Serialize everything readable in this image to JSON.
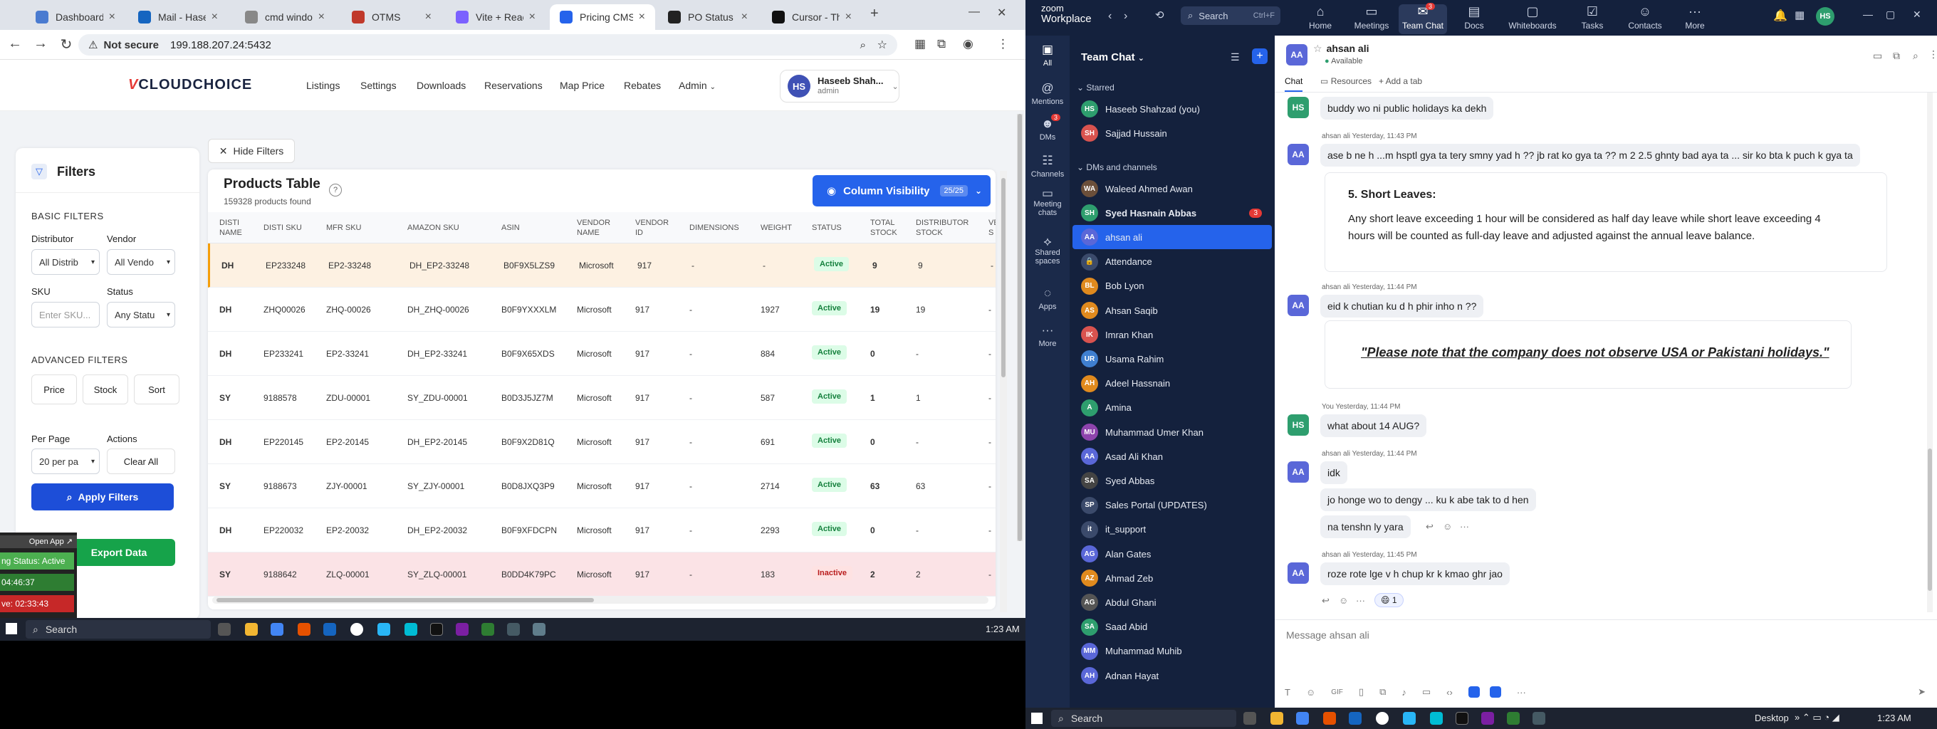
{
  "browser": {
    "tabs": [
      {
        "label": "Dashboard",
        "color": "#4a7bd0"
      },
      {
        "label": "Mail - Haseeb",
        "color": "#1565c0"
      },
      {
        "label": "cmd windows",
        "color": "#888888"
      },
      {
        "label": "OTMS",
        "color": "#c0392b"
      },
      {
        "label": "Vite + React",
        "color": "#7b61ff"
      },
      {
        "label": "Pricing CMS",
        "color": "#2563eb"
      },
      {
        "label": "PO Status API",
        "color": "#222222"
      },
      {
        "label": "Cursor - The A",
        "color": "#111111"
      }
    ],
    "new_tab_icon": "+",
    "not_secure": "Not secure",
    "url": "199.188.207.24:5432"
  },
  "app": {
    "logo_mark": "V",
    "logo_text": "CLOUDCHOICE",
    "nav": [
      "Listings",
      "Settings",
      "Downloads",
      "Reservations",
      "Map Price",
      "Rebates",
      "Admin"
    ],
    "user": {
      "initials": "HS",
      "name": "Haseeb Shah...",
      "role": "admin"
    },
    "hide_filters": "Hide Filters",
    "filters": {
      "title": "Filters",
      "basic": "BASIC FILTERS",
      "distributor_label": "Distributor",
      "distributor_value": "All Distrib",
      "vendor_label": "Vendor",
      "vendor_value": "All Vendo",
      "sku_label": "SKU",
      "sku_placeholder": "Enter SKU...",
      "status_label": "Status",
      "status_value": "Any Statu",
      "advanced": "ADVANCED FILTERS",
      "price": "Price",
      "stock": "Stock",
      "sort": "Sort",
      "per_page_label": "Per Page",
      "per_page_value": "20 per pa",
      "actions_label": "Actions",
      "clear_all": "Clear All",
      "apply": "Apply Filters",
      "export": "Export Data"
    },
    "table": {
      "title": "Products Table",
      "count": "159328 products found",
      "column_visibility": "Column Visibility",
      "column_count": "25/25",
      "headers": [
        "DISTI NAME",
        "DISTI SKU",
        "MFR SKU",
        "AMAZON SKU",
        "ASIN",
        "VENDOR NAME",
        "VENDOR ID",
        "DIMENSIONS",
        "WEIGHT",
        "STATUS",
        "TOTAL STOCK",
        "DISTRIBUTOR STOCK",
        "VE S"
      ],
      "rows": [
        [
          "DH",
          "EP233248",
          "EP2-33248",
          "DH_EP2-33248",
          "B0F9X5LZS9",
          "Microsoft",
          "917",
          "-",
          "-",
          "Active",
          "9",
          "9",
          "-"
        ],
        [
          "DH",
          "ZHQ00026",
          "ZHQ-00026",
          "DH_ZHQ-00026",
          "B0F9YXXXLM",
          "Microsoft",
          "917",
          "-",
          "1927",
          "Active",
          "19",
          "19",
          "-"
        ],
        [
          "DH",
          "EP233241",
          "EP2-33241",
          "DH_EP2-33241",
          "B0F9X65XDS",
          "Microsoft",
          "917",
          "-",
          "884",
          "Active",
          "0",
          "-",
          "-"
        ],
        [
          "SY",
          "9188578",
          "ZDU-00001",
          "SY_ZDU-00001",
          "B0D3J5JZ7M",
          "Microsoft",
          "917",
          "-",
          "587",
          "Active",
          "1",
          "1",
          "-"
        ],
        [
          "DH",
          "EP220145",
          "EP2-20145",
          "DH_EP2-20145",
          "B0F9X2D81Q",
          "Microsoft",
          "917",
          "-",
          "691",
          "Active",
          "0",
          "-",
          "-"
        ],
        [
          "SY",
          "9188673",
          "ZJY-00001",
          "SY_ZJY-00001",
          "B0D8JXQ3P9",
          "Microsoft",
          "917",
          "-",
          "2714",
          "Active",
          "63",
          "63",
          "-"
        ],
        [
          "DH",
          "EP220032",
          "EP2-20032",
          "DH_EP2-20032",
          "B0F9XFDCPN",
          "Microsoft",
          "917",
          "-",
          "2293",
          "Active",
          "0",
          "-",
          "-"
        ],
        [
          "SY",
          "9188642",
          "ZLQ-00001",
          "SY_ZLQ-00001",
          "B0DD4K79PC",
          "Microsoft",
          "917",
          "-",
          "183",
          "Inactive",
          "2",
          "2",
          "-"
        ]
      ]
    },
    "widget": {
      "open_app": "Open App ↗",
      "status": "ng Status: Active",
      "time1": "04:46:37",
      "time2": "ve: 02:33:43"
    }
  },
  "taskbar_left": {
    "search": "Search",
    "time": "1:23 AM"
  },
  "zoom": {
    "brand_top": "zoom",
    "brand": "Workplace",
    "search": "Search",
    "search_shortcut": "Ctrl+F",
    "tabs": [
      "Home",
      "Meetings",
      "Team Chat",
      "Docs",
      "Whiteboards",
      "Tasks",
      "Contacts",
      "More"
    ],
    "team_chat_badge": "3",
    "rail": [
      "All",
      "Mentions",
      "DMs",
      "Channels",
      "Meeting chats",
      "Shared spaces",
      "Apps",
      "More"
    ],
    "dms_badge": "3",
    "list_title": "Team Chat",
    "starred": "Starred",
    "dms_channels": "DMs and channels",
    "starred_items": [
      {
        "name": "Haseeb Shahzad (you)",
        "ini": "HS",
        "color": "#2e9e6e"
      },
      {
        "name": "Sajjad Hussain",
        "ini": "SH",
        "color": "#d9534f"
      }
    ],
    "items": [
      {
        "name": "Waleed Ahmed Awan",
        "ini": "WA",
        "color": "#6b4f3a"
      },
      {
        "name": "Syed Hasnain Abbas",
        "ini": "SH",
        "color": "#2e9e6e",
        "badge": "3"
      },
      {
        "name": "ahsan ali",
        "ini": "AA",
        "color": "#5a67d8"
      },
      {
        "name": "Attendance",
        "ini": "🔒",
        "color": "#3b4a6b"
      },
      {
        "name": "Bob Lyon",
        "ini": "BL",
        "color": "#e08a1e"
      },
      {
        "name": "Ahsan Saqib",
        "ini": "AS",
        "color": "#e08a1e"
      },
      {
        "name": "Imran Khan",
        "ini": "IK",
        "color": "#d9534f"
      },
      {
        "name": "Usama Rahim",
        "ini": "UR",
        "color": "#3f7fd0"
      },
      {
        "name": "Adeel Hassnain",
        "ini": "AH",
        "color": "#e08a1e"
      },
      {
        "name": "Amina",
        "ini": "A",
        "color": "#2e9e6e"
      },
      {
        "name": "Muhammad Umer Khan",
        "ini": "MU",
        "color": "#8e44ad"
      },
      {
        "name": "Asad Ali Khan",
        "ini": "AA",
        "color": "#5a67d8"
      },
      {
        "name": "Syed Abbas",
        "ini": "SA",
        "color": "#444"
      },
      {
        "name": "Sales Portal (UPDATES)",
        "ini": "SP",
        "color": "#3b4a6b"
      },
      {
        "name": "it_support",
        "ini": "it",
        "color": "#3b4a6b"
      },
      {
        "name": "Alan Gates",
        "ini": "AG",
        "color": "#5a67d8"
      },
      {
        "name": "Ahmad Zeb",
        "ini": "AZ",
        "color": "#e08a1e"
      },
      {
        "name": "Abdul Ghani",
        "ini": "AG",
        "color": "#555"
      },
      {
        "name": "Saad Abid",
        "ini": "SA",
        "color": "#2e9e6e"
      },
      {
        "name": "Muhammad Muhib",
        "ini": "MM",
        "color": "#5a67d8"
      },
      {
        "name": "Adnan Hayat",
        "ini": "AH",
        "color": "#5a67d8"
      }
    ],
    "chat": {
      "name": "ahsan ali",
      "status": "Available",
      "tabs": [
        "Chat",
        "Resources",
        "+ Add a tab"
      ],
      "m0": "buddy wo ni public holidays ka dekh",
      "m1_meta": "ahsan ali  Yesterday, 11:43 PM",
      "m1": "ase b ne h ...m hsptl gya ta tery smny yad h ?? jb rat ko gya ta ?? m 2 2.5 ghnty bad aya ta ... sir ko bta k puch k gya ta",
      "card1_title": "5. Short Leaves:",
      "card1_body1": "Any short leave exceeding 1 hour will be considered as half day leave while short leave exceeding 4",
      "card1_body2": "hours will be counted as full-day leave and adjusted against the annual leave balance.",
      "m2_meta": "ahsan ali  Yesterday, 11:44 PM",
      "m2": "eid k chutian ku d h phir inho n ??",
      "card2": "\"Please note that the company does not observe USA or Pakistani holidays.\"",
      "m3_meta": "You  Yesterday, 11:44 PM",
      "m3": "what about 14 AUG?",
      "m4_meta": "ahsan ali  Yesterday, 11:44 PM",
      "m4a": "idk",
      "m4b": "jo honge wo to dengy ... ku k abe tak to d hen",
      "m4c": "na tenshn ly yara",
      "m5_meta": "ahsan ali  Yesterday, 11:45 PM",
      "m5": "roze rote lge v h chup kr k kmao ghr jao",
      "reaction": "😄 1",
      "composer": "Message ahsan ali"
    }
  },
  "taskbar_right": {
    "search": "Search",
    "desktop": "Desktop",
    "time": "1:23 AM"
  }
}
